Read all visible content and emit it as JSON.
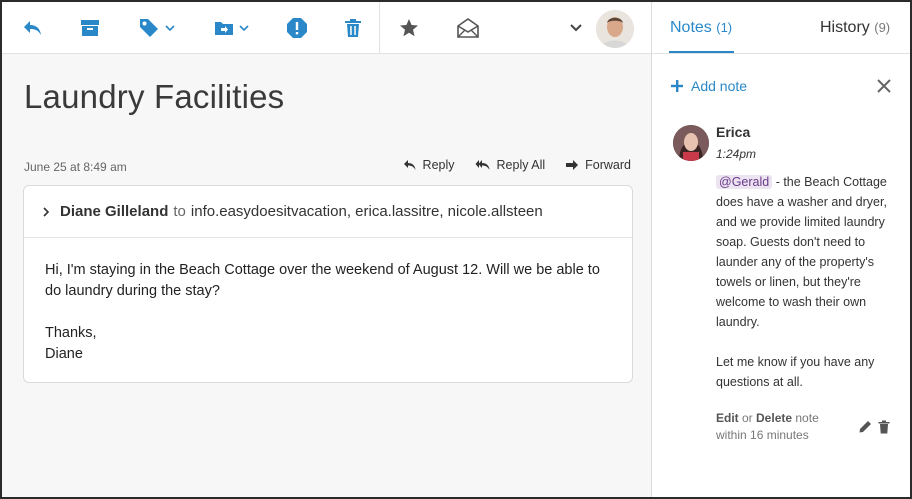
{
  "toolbar": {
    "icons": [
      "reply-icon",
      "archive-icon",
      "tag-icon",
      "move-to-folder-icon",
      "spam-icon",
      "delete-icon",
      "star-icon",
      "mark-unread-icon",
      "chevron-down-icon"
    ],
    "accent_color": "#2a88c8"
  },
  "message": {
    "subject": "Laundry Facilities",
    "date": "June 25 at 8:49 am",
    "actions": {
      "reply": "Reply",
      "reply_all": "Reply All",
      "forward": "Forward"
    },
    "sender": "Diane Gilleland",
    "to_word": "to",
    "recipients": "info.easydoesitvacation, erica.lassitre, nicole.allsteen",
    "body": {
      "line1": "Hi, I'm staying in the Beach Cottage over the weekend of August 12. Will we be able to do laundry during the stay?",
      "line2": "Thanks,",
      "line3": "Diane"
    }
  },
  "sidebar": {
    "tabs": {
      "notes_label": "Notes",
      "notes_count": "(1)",
      "history_label": "History",
      "history_count": "(9)"
    },
    "add_note": "Add note",
    "note": {
      "author": "Erica",
      "time": "1:24pm",
      "mention": "@Gerald",
      "text_after_mention": " - the Beach Cottage does have a washer and dryer, and we provide limited laundry soap. Guests don't need to launder any of the property's towels or linen, but they're welcome to wash their own laundry.",
      "text_para2": "Let me know if you have any questions at all.",
      "meta_edit": "Edit",
      "meta_or": " or ",
      "meta_delete": "Delete",
      "meta_note": " note",
      "meta_within": "within 16 minutes"
    }
  }
}
